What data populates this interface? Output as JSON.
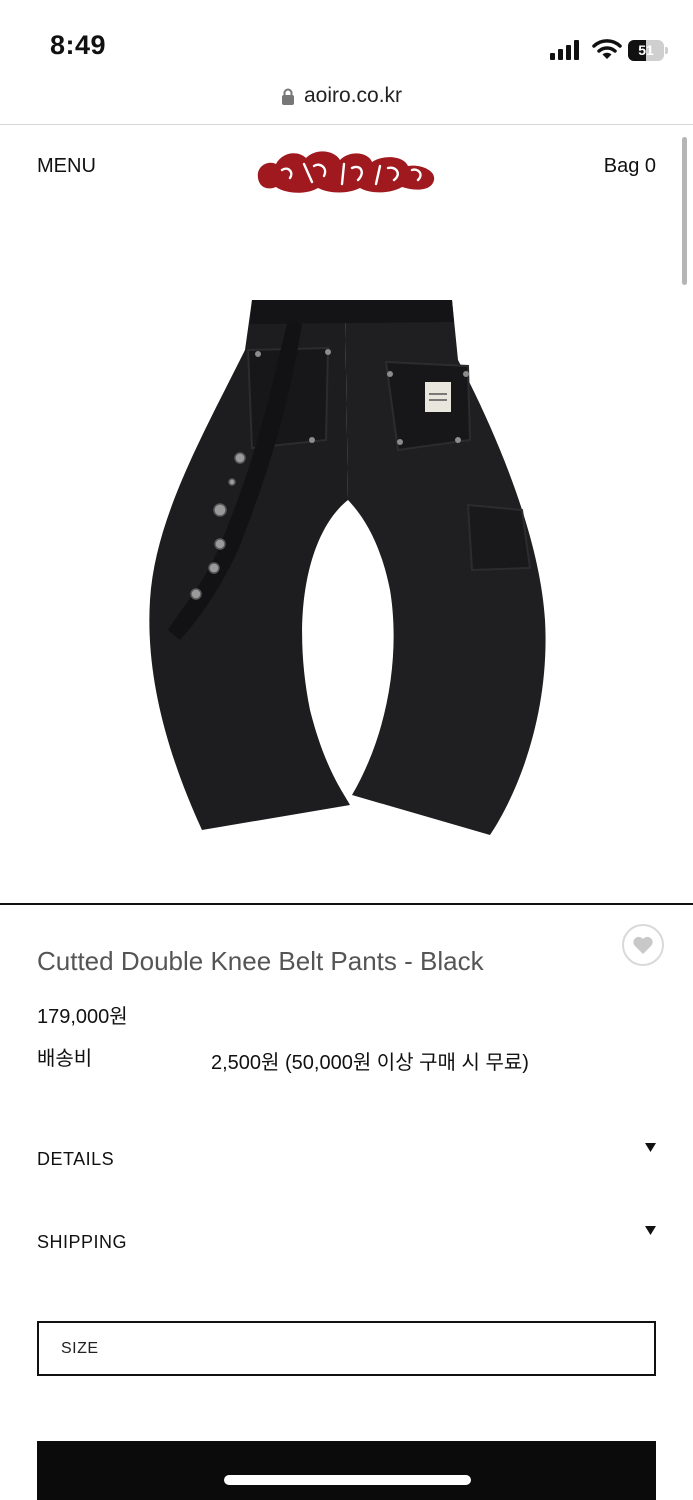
{
  "status_bar": {
    "time": "8:49",
    "battery": "51",
    "battery_level": 0.51,
    "icons": [
      "signal-icon",
      "wifi-icon",
      "battery-icon"
    ]
  },
  "browser": {
    "url": "aoiro.co.kr",
    "lock_icon": "lock-icon"
  },
  "header": {
    "menu_label": "MENU",
    "logo_text": "aoiro",
    "bag_label": "Bag 0"
  },
  "product": {
    "image_alt": "black double knee belt pants",
    "title": "Cutted Double Knee Belt Pants - Black",
    "price": "179,000원",
    "shipping_label": "배송비",
    "shipping_value": "2,500원 (50,000원 이상 구매 시 무료)",
    "wishlist_icon": "heart-icon"
  },
  "accordions": {
    "details": "DETAILS",
    "shipping": "SHIPPING"
  },
  "options": {
    "size_placeholder": "SIZE"
  },
  "colors": {
    "logo": "#a0191e",
    "text": "#111111",
    "title": "#555555",
    "button": "#0b0b0b"
  }
}
